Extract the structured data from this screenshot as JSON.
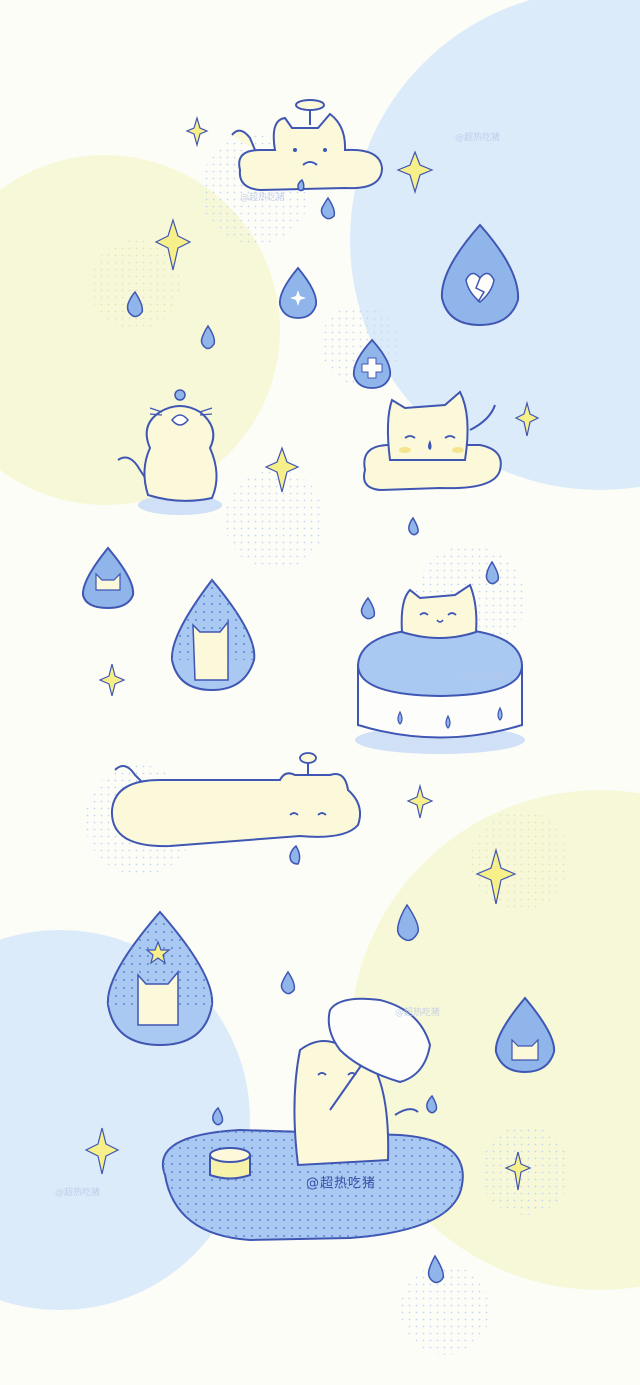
{
  "wallpaper": {
    "palette": {
      "background": "#fdfdf8",
      "blue_blob": "#dcebfa",
      "yellow_blob": "#f7f8d8",
      "cat_fill": "#fbf9da",
      "outline": "#3f56b3",
      "drop_fill": "#8fb5ea",
      "puddle_fill": "#a9c8f2",
      "sparkle_fill": "#f6ef8a"
    },
    "signature_text": "@超热吃猪",
    "watermark_text": "@超热吃猪",
    "icons": [
      "cat-icon",
      "raindrop-icon",
      "sparkle-icon",
      "broken-heart-icon",
      "plus-icon",
      "star-icon",
      "leaf-umbrella-icon"
    ]
  }
}
